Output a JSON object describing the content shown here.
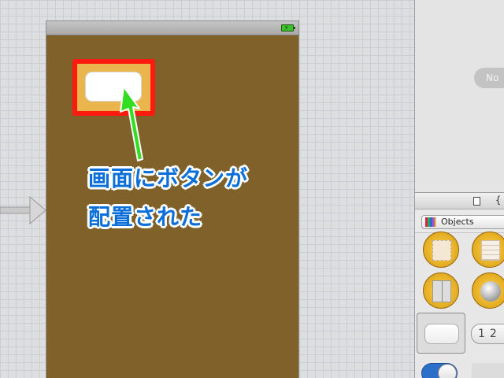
{
  "annotation": {
    "line1": "画面にボタンが",
    "line2": "配置された",
    "text_color": "#0a6fd8",
    "arrow_color": "#33dd22",
    "highlight_color": "#ff1a0f"
  },
  "device": {
    "background_color": "#7f6129",
    "status_icon": "battery-charging-icon"
  },
  "inspector": {
    "no_selection": "No",
    "objects_popup": "Objects",
    "segmented_labels": "12"
  }
}
